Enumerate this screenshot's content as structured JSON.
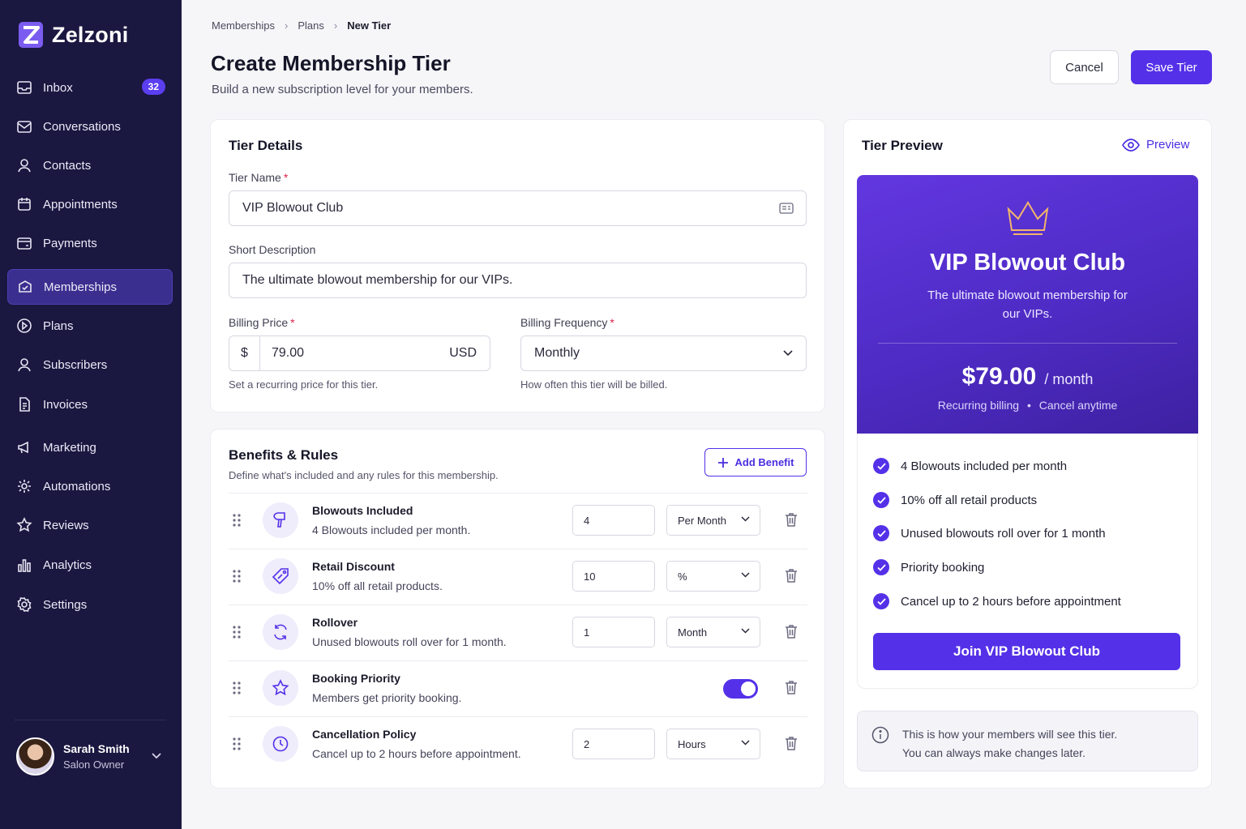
{
  "app": {
    "name": "Zelzoni"
  },
  "sidebar": {
    "items": [
      {
        "label": "Inbox",
        "icon": "inbox-icon",
        "badge": "32"
      },
      {
        "label": "Conversations",
        "icon": "conversations-icon"
      },
      {
        "label": "Contacts",
        "icon": "contacts-icon"
      },
      {
        "label": "Appointments",
        "icon": "calendar-icon"
      },
      {
        "label": "Payments",
        "icon": "payments-icon"
      },
      {
        "label": "Memberships",
        "icon": "memberships-icon",
        "active": true
      },
      {
        "label": "Plans",
        "icon": "plans-icon"
      },
      {
        "label": "Subscribers",
        "icon": "subscribers-icon"
      },
      {
        "label": "Invoices",
        "icon": "invoices-icon"
      },
      {
        "label": "Marketing",
        "icon": "megaphone-icon"
      },
      {
        "label": "Automations",
        "icon": "automations-icon"
      },
      {
        "label": "Reviews",
        "icon": "star-icon"
      },
      {
        "label": "Analytics",
        "icon": "analytics-icon"
      },
      {
        "label": "Settings",
        "icon": "gear-icon"
      }
    ],
    "user": {
      "name": "Sarah Smith",
      "role": "Salon Owner"
    }
  },
  "header": {
    "breadcrumb": [
      "Memberships",
      "Plans",
      "New Tier"
    ],
    "title": "Create Membership Tier",
    "subtitle": "Build a new subscription level for your members.",
    "cancel_label": "Cancel",
    "save_label": "Save Tier"
  },
  "tier_details": {
    "title": "Tier Details",
    "name_label": "Tier Name",
    "name_value": "VIP Blowout Club",
    "desc_label": "Short Description",
    "desc_value": "The ultimate blowout membership for our VIPs.",
    "price_label": "Billing Price",
    "currency_symbol": "$",
    "price_value": "79.00",
    "currency": "USD",
    "price_hint": "Set a recurring price for this tier.",
    "frequency_label": "Billing Frequency",
    "frequency_value": "Monthly",
    "frequency_hint": "How often this tier will be billed.",
    "required_mark": "*"
  },
  "benefits": {
    "title": "Benefits & Rules",
    "subtitle": "Define what's included and any rules for this membership.",
    "add_label": "Add Benefit",
    "rows": [
      {
        "title": "Blowouts Included",
        "desc": "4 Blowouts included per month.",
        "value": "4",
        "unit": "Per Month",
        "icon": "hair-dryer-icon"
      },
      {
        "title": "Retail Discount",
        "desc": "10% off all retail products.",
        "value": "10",
        "unit": "%",
        "icon": "tag-icon"
      },
      {
        "title": "Rollover",
        "desc": "Unused blowouts roll over for 1 month.",
        "value": "1",
        "unit": "Month",
        "icon": "refresh-icon"
      },
      {
        "title": "Booking Priority",
        "desc": "Members get priority booking.",
        "toggle": true,
        "icon": "star-icon"
      },
      {
        "title": "Cancellation Policy",
        "desc": "Cancel up to 2 hours before appointment.",
        "value": "2",
        "unit": "Hours",
        "icon": "clock-icon"
      }
    ]
  },
  "preview": {
    "title": "Tier Preview",
    "link_label": "Preview",
    "tier_name": "VIP Blowout Club",
    "tier_desc": "The ultimate blowout membership for our VIPs.",
    "price": "$79.00",
    "period": "/ month",
    "meta_left": "Recurring billing",
    "meta_dot": "•",
    "meta_right": "Cancel anytime",
    "features": [
      "4 Blowouts included per month",
      "10% off all retail products",
      "Unused blowouts roll over for 1 month",
      "Priority booking",
      "Cancel up to 2 hours before appointment"
    ],
    "join_label": "Join VIP Blowout Club",
    "note_line1": "This is how your members will see this tier.",
    "note_line2": "You can always make changes later.",
    "accent": "#5431e8"
  }
}
